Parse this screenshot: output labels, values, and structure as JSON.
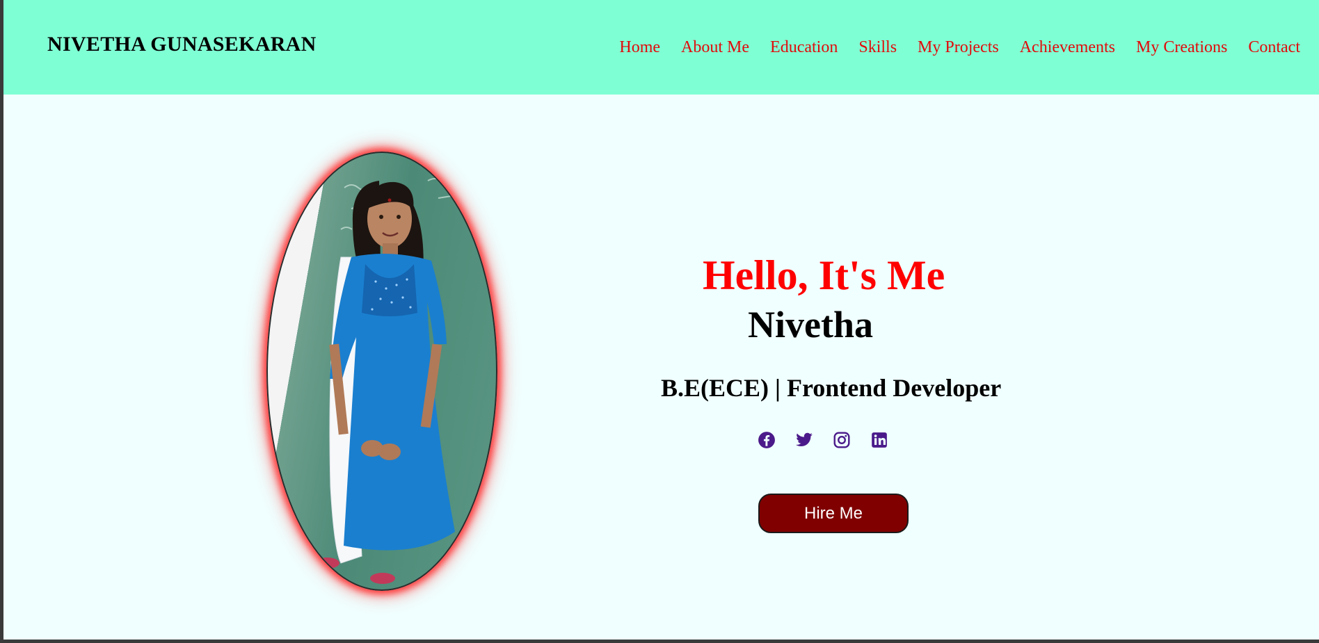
{
  "header": {
    "brand": "NIVETHA GUNASEKARAN",
    "nav": [
      {
        "label": "Home"
      },
      {
        "label": "About Me"
      },
      {
        "label": "Education"
      },
      {
        "label": "Skills"
      },
      {
        "label": "My Projects"
      },
      {
        "label": "Achievements"
      },
      {
        "label": "My Creations"
      },
      {
        "label": "Contact"
      }
    ]
  },
  "hero": {
    "greeting": "Hello, It's Me",
    "name": "Nivetha",
    "role": "B.E(ECE) | Frontend Developer",
    "socials": [
      {
        "icon": "facebook-icon"
      },
      {
        "icon": "twitter-icon"
      },
      {
        "icon": "instagram-icon"
      },
      {
        "icon": "linkedin-icon"
      }
    ],
    "cta_label": "Hire Me"
  },
  "colors": {
    "navbar_bg": "#7fffd4",
    "page_bg": "#f0ffff",
    "nav_link": "#e10b0b",
    "greeting": "#ff0000",
    "social_icon": "#4b1a8a",
    "button_bg": "#800000",
    "photo_glow": "#ff2828"
  }
}
